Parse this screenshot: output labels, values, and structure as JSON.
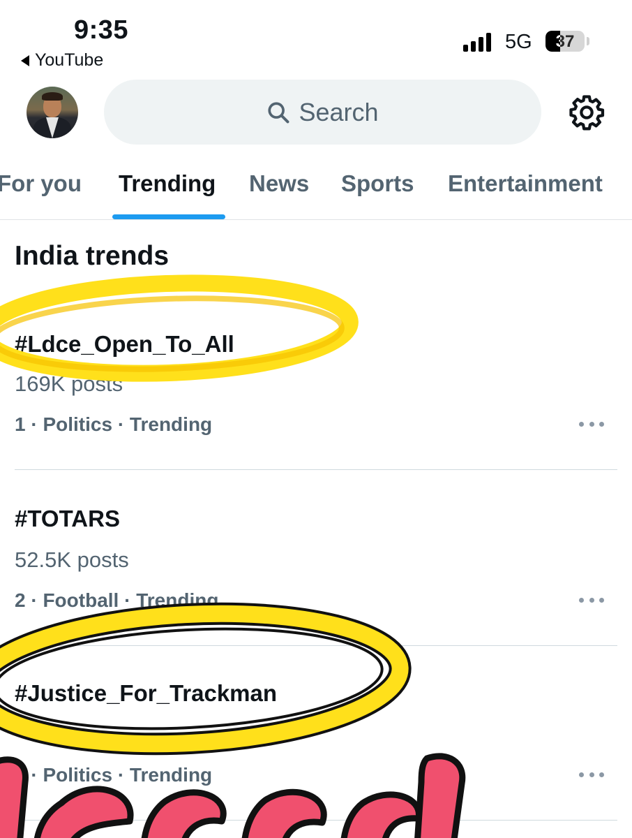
{
  "status_bar": {
    "time": "9:35",
    "back_app": "YouTube",
    "network": "5G",
    "battery": "37",
    "battery_level": 0.37
  },
  "header": {
    "search_placeholder": "Search",
    "avatar_icon": "profile-avatar",
    "settings_icon": "gear-icon"
  },
  "tabs": [
    {
      "label": "For you"
    },
    {
      "label": "Trending",
      "active": true
    },
    {
      "label": "News"
    },
    {
      "label": "Sports"
    },
    {
      "label": "Entertainment"
    }
  ],
  "section_title": "India trends",
  "trends": [
    {
      "tag": "#Ldce_Open_To_All",
      "posts": "169K posts",
      "meta": "1 · Politics · Trending"
    },
    {
      "tag": "#TOTARS",
      "posts": "52.5K posts",
      "meta": "2 · Football · Trending"
    },
    {
      "tag": "#Justice_For_Trackman",
      "meta": "3 · Politics · Trending"
    }
  ],
  "colors": {
    "accent": "#1d9bf0",
    "highlight": "#ffe01b",
    "sticker": "#f0506e"
  }
}
